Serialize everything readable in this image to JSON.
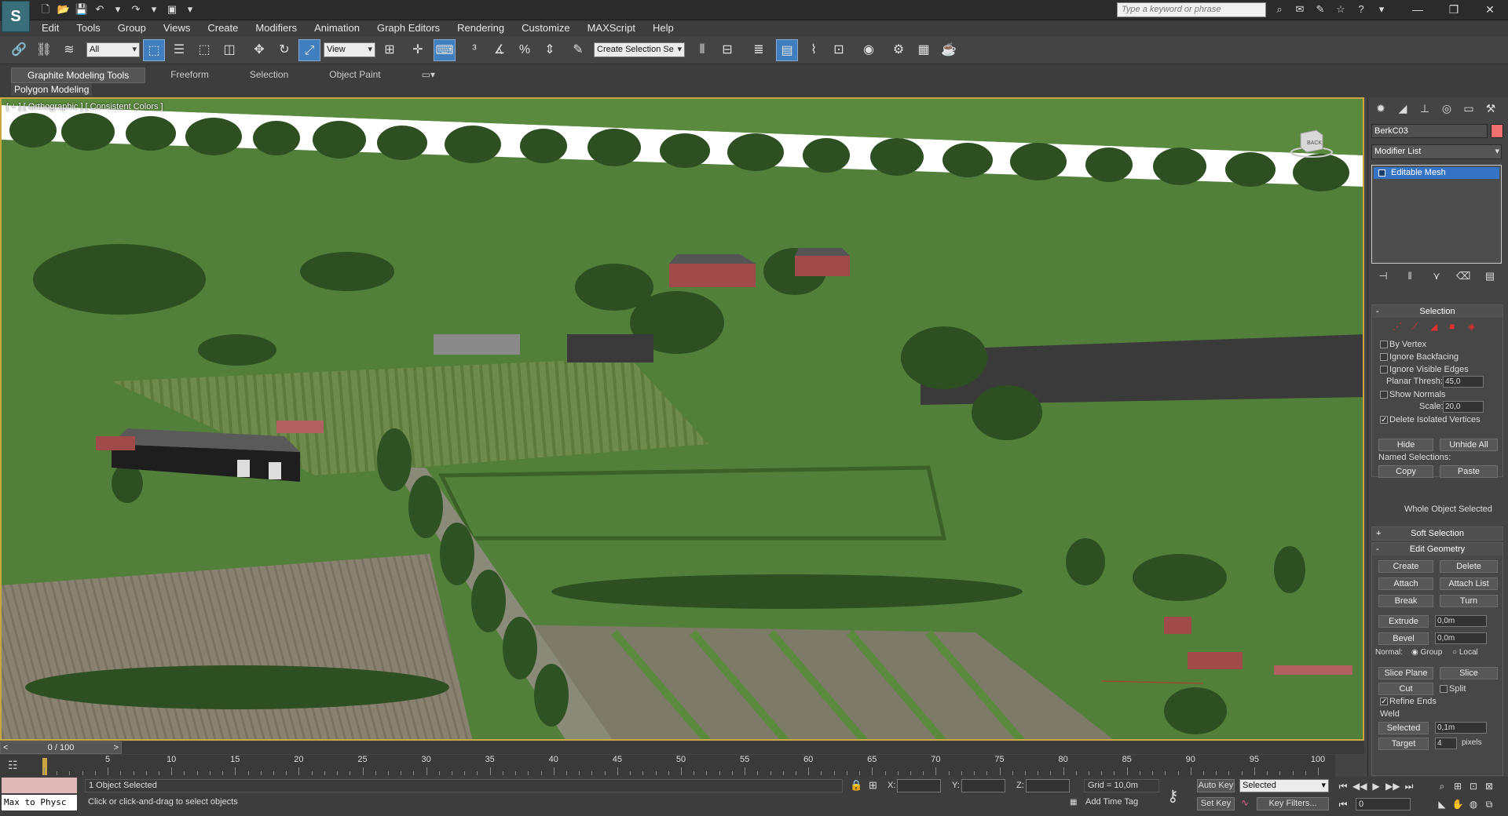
{
  "title_bar": {
    "search_placeholder": "Type a keyword or phrase"
  },
  "menu": [
    "Edit",
    "Tools",
    "Group",
    "Views",
    "Create",
    "Modifiers",
    "Animation",
    "Graph Editors",
    "Rendering",
    "Customize",
    "MAXScript",
    "Help"
  ],
  "toolbar": {
    "selection_filter": "All",
    "ref_coord": "View",
    "named_selection": "Create Selection Se"
  },
  "ribbon": {
    "tabs": [
      "Graphite Modeling Tools",
      "Freeform",
      "Selection",
      "Object Paint"
    ],
    "active_panel": "Polygon Modeling"
  },
  "viewport": {
    "label": "[ + ] [ Orthographic ] [ Consistent Colors ]",
    "viewcube_label": "BACK"
  },
  "command_panel": {
    "object_name": "BerkC03",
    "object_color": "#f07070",
    "modifier_list": "Modifier List",
    "stack_item": "Editable Mesh",
    "selection": {
      "title": "Selection",
      "by_vertex": "By Vertex",
      "ignore_backfacing": "Ignore Backfacing",
      "ignore_visible_edges": "Ignore Visible Edges",
      "planar_thresh_label": "Planar Thresh:",
      "planar_thresh": "45,0",
      "show_normals": "Show Normals",
      "scale_label": "Scale:",
      "scale": "20,0",
      "delete_isolated": "Delete Isolated Vertices",
      "hide": "Hide",
      "unhide_all": "Unhide All",
      "named_selections": "Named Selections:",
      "copy": "Copy",
      "paste": "Paste",
      "whole_object": "Whole Object Selected"
    },
    "soft_selection": "Soft Selection",
    "edit_geometry": {
      "title": "Edit Geometry",
      "create": "Create",
      "delete": "Delete",
      "attach": "Attach",
      "attach_list": "Attach List",
      "break": "Break",
      "turn": "Turn",
      "extrude": "Extrude",
      "extrude_val": "0,0m",
      "bevel": "Bevel",
      "bevel_val": "0,0m",
      "normal_label": "Normal:",
      "group": "Group",
      "local": "Local",
      "slice_plane": "Slice Plane",
      "slice": "Slice",
      "cut": "Cut",
      "split": "Split",
      "refine_ends": "Refine Ends",
      "weld": "Weld",
      "selected": "Selected",
      "selected_val": "0,1m",
      "target": "Target",
      "target_val": "4",
      "pixels": "pixels"
    }
  },
  "timeline": {
    "frame_range": "0 / 100",
    "ticks": [
      "5",
      "10",
      "15",
      "20",
      "25",
      "30",
      "35",
      "40",
      "45",
      "50",
      "55",
      "60",
      "65",
      "70",
      "75",
      "80",
      "85",
      "90",
      "95",
      "100"
    ]
  },
  "status": {
    "maxscript": "Max to Physc",
    "selected_count": "1 Object Selected",
    "prompt": "Click or click-and-drag to select objects",
    "x_label": "X:",
    "y_label": "Y:",
    "z_label": "Z:",
    "grid": "Grid = 10,0m",
    "add_time_tag": "Add Time Tag",
    "auto_key": "Auto Key",
    "set_key": "Set Key",
    "key_mode": "Selected",
    "key_filters": "Key Filters...",
    "frame": "0"
  }
}
